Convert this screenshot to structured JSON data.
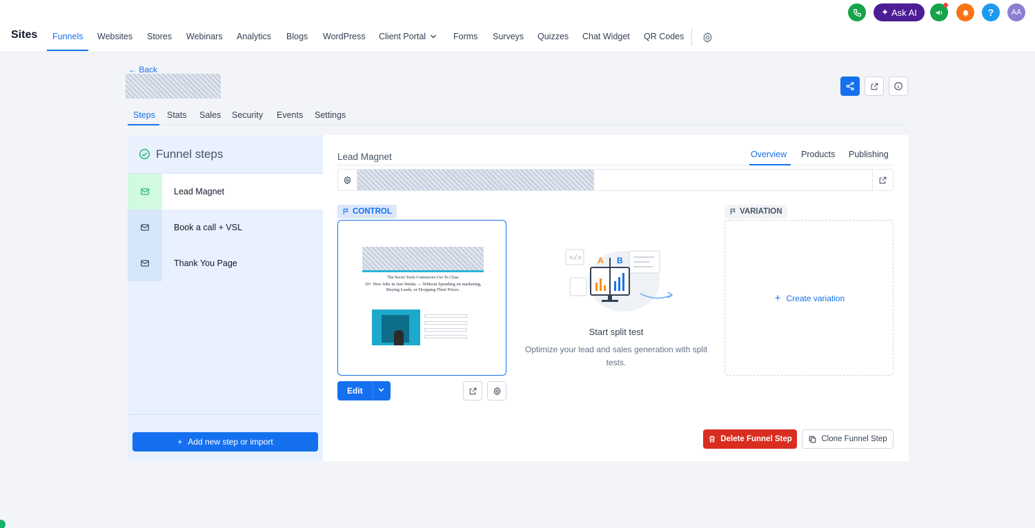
{
  "utility": {
    "ask_ai_label": "Ask AI",
    "avatar_initials": "AA",
    "help_glyph": "?",
    "colors": {
      "phone": "#16a34a",
      "ask_ai": "#4c1d95",
      "megaphone": "#16a34a",
      "bell": "#f97316",
      "help": "#1d9bf0",
      "avatar": "#8b7fd3"
    }
  },
  "nav": {
    "app_title": "Sites",
    "items": [
      "Funnels",
      "Websites",
      "Stores",
      "Webinars",
      "Analytics",
      "Blogs",
      "WordPress",
      "Client Portal",
      "Forms",
      "Surveys",
      "Quizzes",
      "Chat Widget",
      "QR Codes"
    ],
    "active": "Funnels",
    "accent": "#1570ef"
  },
  "header": {
    "back_label": "← Back"
  },
  "funnel_tabs": [
    "Steps",
    "Stats",
    "Sales",
    "Security",
    "Events",
    "Settings"
  ],
  "funnel_tabs_active": "Steps",
  "left_panel": {
    "title": "Funnel steps",
    "steps": [
      {
        "label": "Lead Magnet",
        "icon": "mail-icon",
        "active": true
      },
      {
        "label": "Book a call + VSL",
        "icon": "mail-icon",
        "active": false
      },
      {
        "label": "Thank You Page",
        "icon": "mail-icon",
        "active": false
      }
    ],
    "add_button_label": "Add new step or import"
  },
  "right_panel": {
    "step_title": "Lead Magnet",
    "tabs": [
      "Overview",
      "Products",
      "Publishing"
    ],
    "active_tab": "Overview",
    "control_badge": "CONTROL",
    "variation_badge": "VARIATION",
    "thumbnail": {
      "line1": "The Secret Tools Contractors Use To Close",
      "line2": "10+ New Jobs in Just Weeks — Without Spending on marketing, Buying Leads, or Dropping Their Prices."
    },
    "edit_label": "Edit",
    "split_test_title": "Start split test",
    "split_test_desc": "Optimize your lead and sales generation with split tests.",
    "create_variation_label": "Create variation",
    "delete_label": "Delete Funnel Step",
    "clone_label": "Clone Funnel Step",
    "danger_color": "#d92d20"
  }
}
